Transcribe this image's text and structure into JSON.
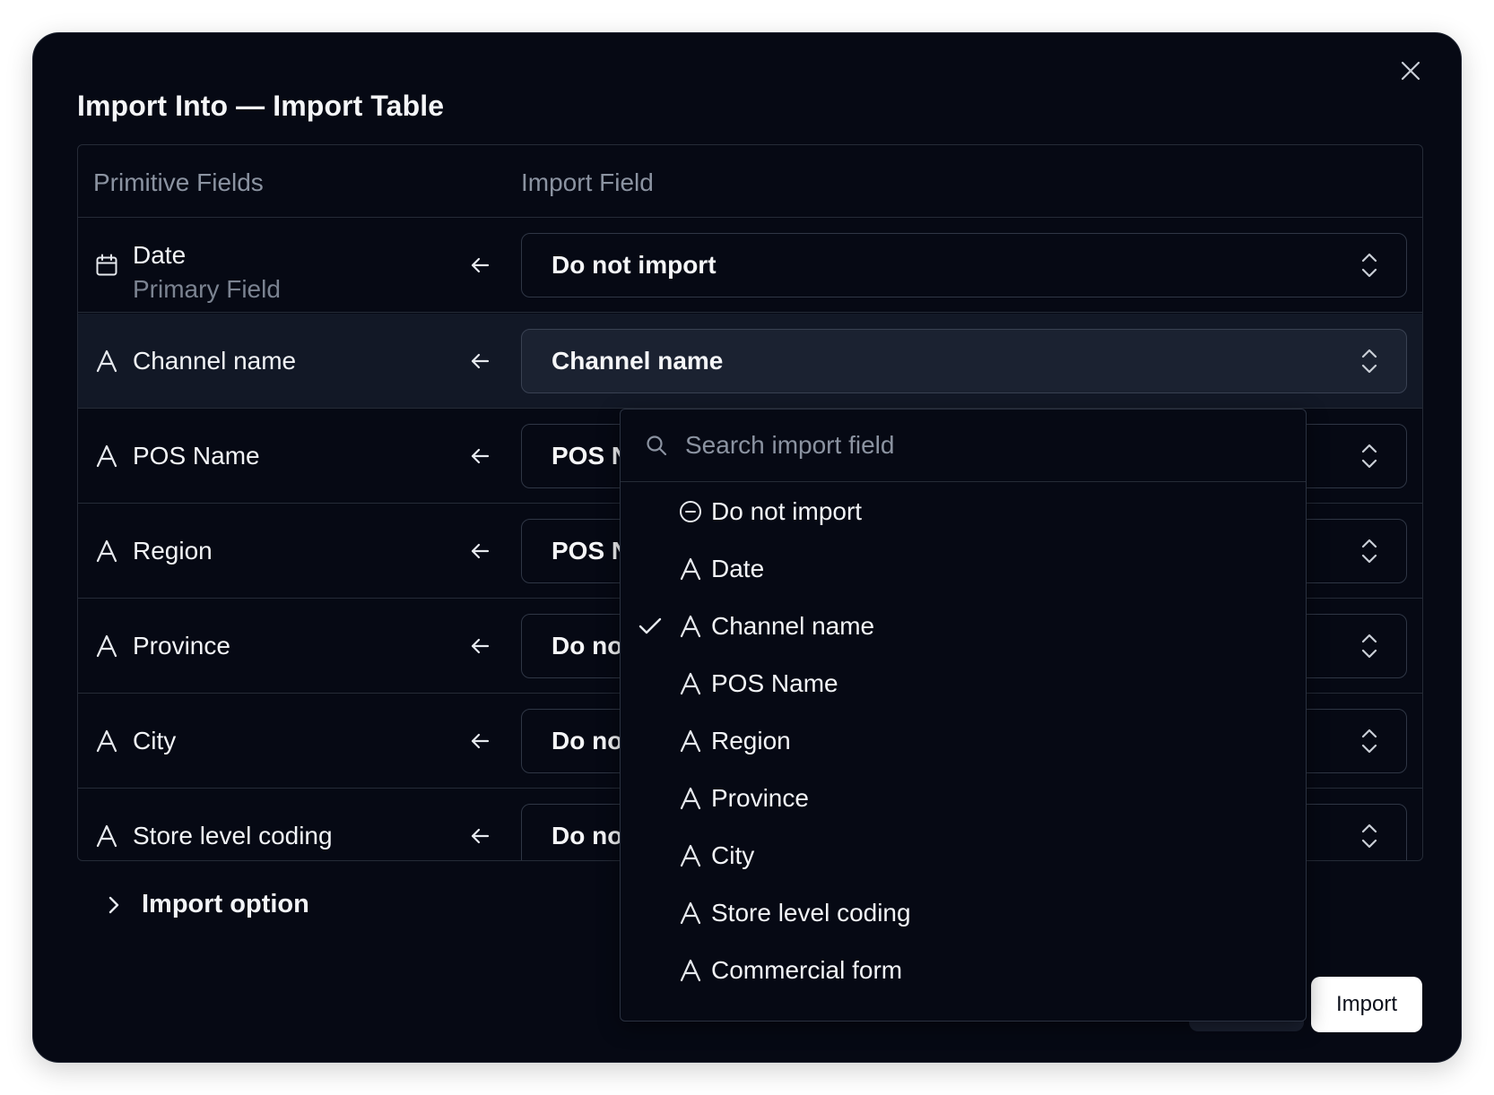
{
  "dialog": {
    "title": "Import Into — Import Table",
    "close_icon": "close-icon"
  },
  "table": {
    "headers": {
      "primitive": "Primitive Fields",
      "import": "Import Field"
    },
    "rows": [
      {
        "field": "Date",
        "subtitle": "Primary Field",
        "icon": "calendar-icon",
        "value": "Do not import",
        "selected": false
      },
      {
        "field": "Channel name",
        "icon": "text-type-icon",
        "value": "Channel name",
        "selected": true
      },
      {
        "field": "POS Name",
        "icon": "text-type-icon",
        "value": "POS N",
        "selected": false
      },
      {
        "field": "Region",
        "icon": "text-type-icon",
        "value": "POS N",
        "selected": false
      },
      {
        "field": "Province",
        "icon": "text-type-icon",
        "value": "Do no",
        "selected": false
      },
      {
        "field": "City",
        "icon": "text-type-icon",
        "value": "Do no",
        "selected": false
      },
      {
        "field": "Store level coding",
        "icon": "text-type-icon",
        "value": "Do no",
        "selected": false
      }
    ]
  },
  "import_option": {
    "label": "Import option",
    "icon": "chevron-right-icon"
  },
  "footer": {
    "import_label": "Import"
  },
  "dropdown": {
    "search_placeholder": "Search import field",
    "search_value": "",
    "selected": "Channel name",
    "items": [
      {
        "label": "Do not import",
        "icon": "minus-circle-icon"
      },
      {
        "label": "Date",
        "icon": "text-type-icon"
      },
      {
        "label": "Channel name",
        "icon": "text-type-icon"
      },
      {
        "label": "POS Name",
        "icon": "text-type-icon"
      },
      {
        "label": "Region",
        "icon": "text-type-icon"
      },
      {
        "label": "Province",
        "icon": "text-type-icon"
      },
      {
        "label": "City",
        "icon": "text-type-icon"
      },
      {
        "label": "Store level coding",
        "icon": "text-type-icon"
      },
      {
        "label": "Commercial form",
        "icon": "text-type-icon"
      }
    ]
  },
  "colors": {
    "background": "#060914",
    "border": "#252b37",
    "text": "#f2f4f7",
    "muted": "#8b93a1",
    "selected_row": "#121826"
  }
}
